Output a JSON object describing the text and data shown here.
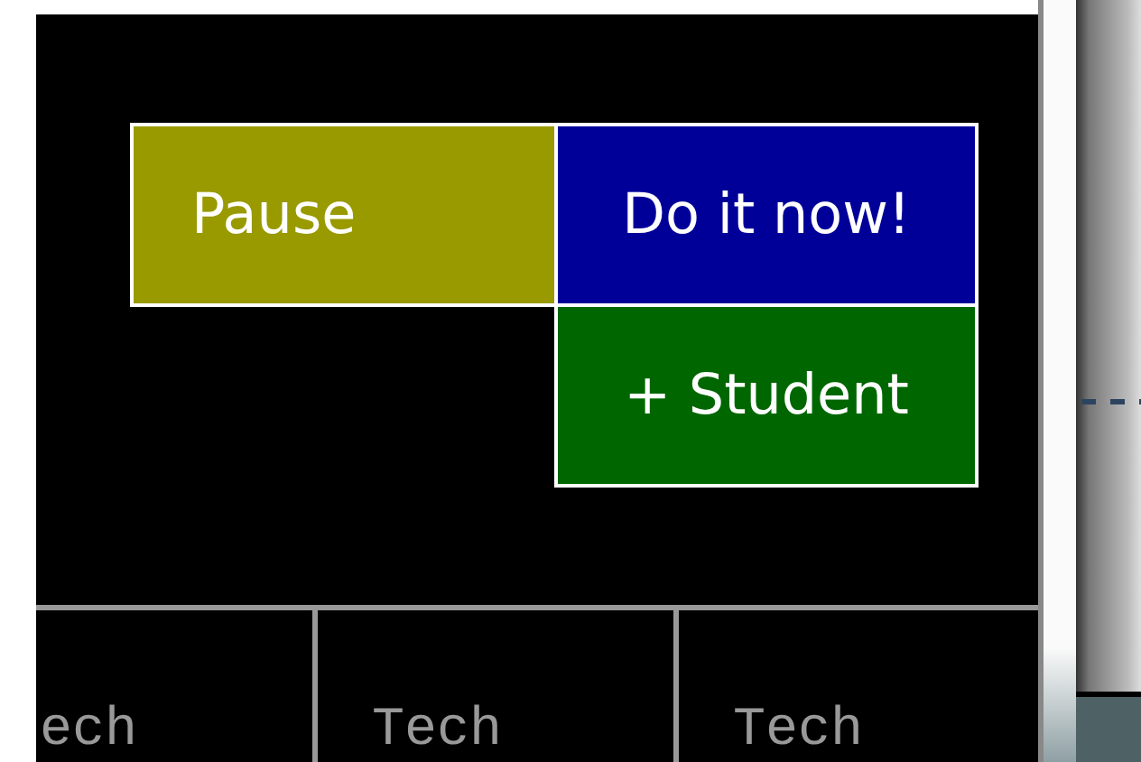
{
  "buttons": [
    {
      "label": "Pause",
      "color": "#999900"
    },
    {
      "label": "Do it now!",
      "color": "#000099"
    },
    {
      "label": "+ Student",
      "color": "#006600"
    }
  ],
  "tabs": [
    {
      "label": "ech"
    },
    {
      "label": "Tech"
    },
    {
      "label": "Tech"
    }
  ]
}
